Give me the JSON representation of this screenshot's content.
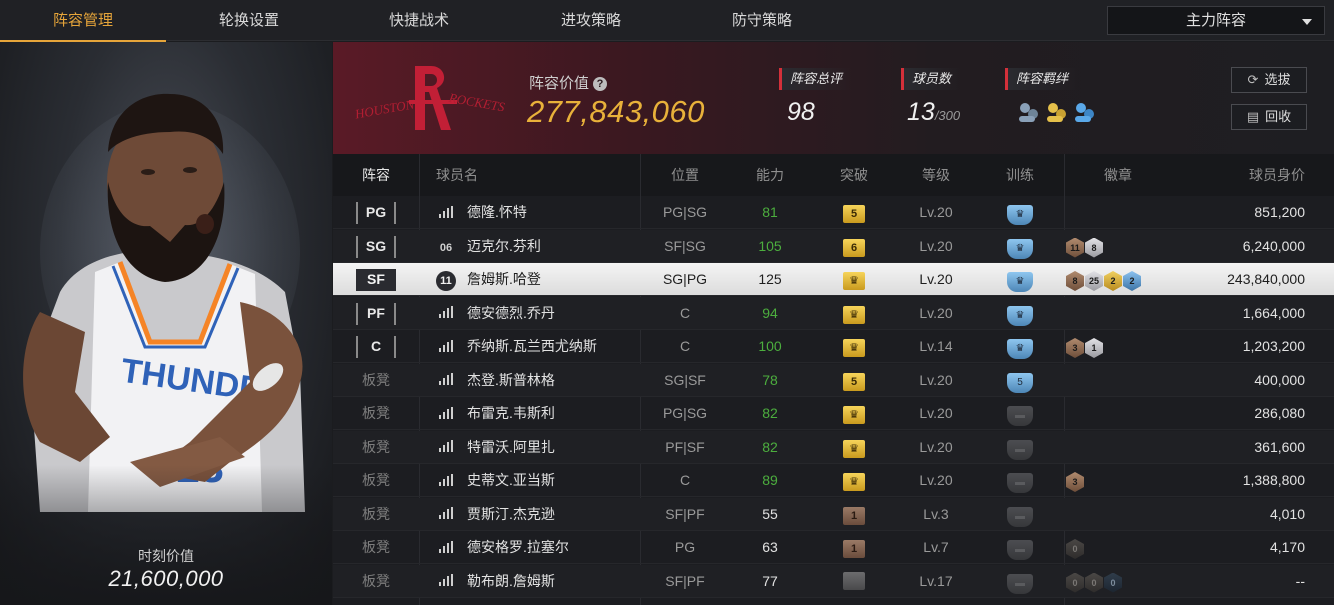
{
  "nav": {
    "tabs": [
      "阵容管理",
      "轮换设置",
      "快捷战术",
      "进攻策略",
      "防守策略"
    ],
    "active_tab": 0,
    "lineup_select": "主力阵容"
  },
  "player_card": {
    "value_label": "时刻价值",
    "value": "21,600,000"
  },
  "team": {
    "logo_text": "HOUSTON ROCKETS",
    "lineup_value_label": "阵容价值",
    "lineup_value": "277,843,060",
    "rating_label": "阵容总评",
    "rating": "98",
    "players_label": "球员数",
    "players_count": "13",
    "players_max": "/300",
    "bond_label": "阵容羁绊",
    "btn_pick": "选拔",
    "btn_recycle": "回收"
  },
  "table": {
    "headers": [
      "阵容",
      "球员名",
      "位置",
      "能力",
      "突破",
      "等级",
      "训练",
      "徽章",
      "球员身价"
    ],
    "rows": [
      {
        "slot": "PG",
        "num": "",
        "name": "德隆.怀特",
        "pos": "PG|SG",
        "ability": "81",
        "green": true,
        "breakthrough": "5",
        "brk_type": "gold",
        "level": "Lv.20",
        "train": "blue",
        "train_text": "",
        "medals": [],
        "value": "851,200"
      },
      {
        "slot": "SG",
        "num": "06",
        "name": "迈克尔.芬利",
        "pos": "SF|SG",
        "ability": "105",
        "green": true,
        "breakthrough": "6",
        "brk_type": "gold",
        "level": "Lv.20",
        "train": "blue",
        "train_text": "",
        "medals": [
          {
            "t": "bronze",
            "n": "11"
          },
          {
            "t": "silver",
            "n": "8"
          }
        ],
        "value": "6,240,000"
      },
      {
        "slot": "SF",
        "num": "11",
        "name": "詹姆斯.哈登",
        "pos": "SG|PG",
        "ability": "125",
        "green": false,
        "breakthrough": "♛",
        "brk_type": "gold",
        "level": "Lv.20",
        "train": "blue",
        "train_text": "",
        "medals": [
          {
            "t": "bronze",
            "n": "8"
          },
          {
            "t": "silver",
            "n": "25"
          },
          {
            "t": "gold",
            "n": "2"
          },
          {
            "t": "blue",
            "n": "2"
          }
        ],
        "value": "243,840,000",
        "selected": true
      },
      {
        "slot": "PF",
        "num": "",
        "name": "德安德烈.乔丹",
        "pos": "C",
        "ability": "94",
        "green": true,
        "breakthrough": "♛",
        "brk_type": "gold",
        "level": "Lv.20",
        "train": "blue",
        "train_text": "",
        "medals": [],
        "value": "1,664,000"
      },
      {
        "slot": "C",
        "num": "",
        "name": "乔纳斯.瓦兰西尤纳斯",
        "pos": "C",
        "ability": "100",
        "green": true,
        "breakthrough": "♛",
        "brk_type": "gold",
        "level": "Lv.14",
        "train": "blue",
        "train_text": "",
        "medals": [
          {
            "t": "bronze",
            "n": "3"
          },
          {
            "t": "silver",
            "n": "1"
          }
        ],
        "value": "1,203,200"
      },
      {
        "slot": "板凳",
        "num": "",
        "name": "杰登.斯普林格",
        "pos": "SG|SF",
        "ability": "78",
        "green": true,
        "breakthrough": "5",
        "brk_type": "gold",
        "level": "Lv.20",
        "train": "blue",
        "train_text": "5",
        "medals": [],
        "value": "400,000"
      },
      {
        "slot": "板凳",
        "num": "",
        "name": "布雷克.韦斯利",
        "pos": "PG|SG",
        "ability": "82",
        "green": true,
        "breakthrough": "♛",
        "brk_type": "gold",
        "level": "Lv.20",
        "train": "gray",
        "train_text": "",
        "medals": [],
        "value": "286,080"
      },
      {
        "slot": "板凳",
        "num": "",
        "name": "特雷沃.阿里扎",
        "pos": "PF|SF",
        "ability": "82",
        "green": true,
        "breakthrough": "♛",
        "brk_type": "gold",
        "level": "Lv.20",
        "train": "gray",
        "train_text": "",
        "medals": [],
        "value": "361,600"
      },
      {
        "slot": "板凳",
        "num": "",
        "name": "史蒂文.亚当斯",
        "pos": "C",
        "ability": "89",
        "green": true,
        "breakthrough": "♛",
        "brk_type": "gold",
        "level": "Lv.20",
        "train": "gray",
        "train_text": "",
        "medals": [
          {
            "t": "bronze",
            "n": "3"
          }
        ],
        "value": "1,388,800"
      },
      {
        "slot": "板凳",
        "num": "",
        "name": "贾斯汀.杰克逊",
        "pos": "SF|PF",
        "ability": "55",
        "green": false,
        "breakthrough": "1",
        "brk_type": "brown",
        "level": "Lv.3",
        "train": "gray",
        "train_text": "",
        "medals": [],
        "value": "4,010"
      },
      {
        "slot": "板凳",
        "num": "",
        "name": "德安格罗.拉塞尔",
        "pos": "PG",
        "ability": "63",
        "green": false,
        "breakthrough": "1",
        "brk_type": "brown",
        "level": "Lv.7",
        "train": "gray",
        "train_text": "",
        "medals": [
          {
            "t": "dark",
            "n": "0"
          }
        ],
        "value": "4,170"
      },
      {
        "slot": "板凳",
        "num": "",
        "name": "勒布朗.詹姆斯",
        "pos": "SF|PF",
        "ability": "77",
        "green": false,
        "breakthrough": "",
        "brk_type": "gray",
        "level": "Lv.17",
        "train": "gray",
        "train_text": "",
        "medals": [
          {
            "t": "dark",
            "n": "0"
          },
          {
            "t": "dark",
            "n": "0"
          },
          {
            "t": "darkb",
            "n": "0"
          }
        ],
        "value": "--"
      }
    ]
  }
}
